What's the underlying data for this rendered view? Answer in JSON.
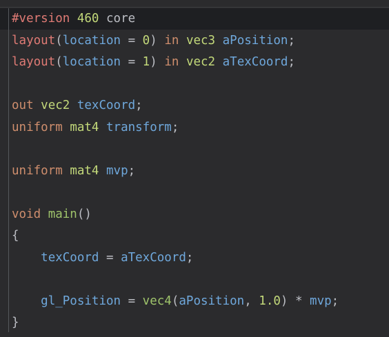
{
  "code": {
    "l1": {
      "directive": "#version",
      "sp1": " ",
      "version": "460",
      "sp2": " ",
      "profile": "core"
    },
    "l2": {
      "kw": "layout",
      "open": "(",
      "loc": "location",
      "eq": " = ",
      "idx": "0",
      "close": ")",
      "sp1": " ",
      "in": "in",
      "sp2": " ",
      "type": "vec3",
      "sp3": " ",
      "name": "aPosition",
      "semi": ";"
    },
    "l3": {
      "kw": "layout",
      "open": "(",
      "loc": "location",
      "eq": " = ",
      "idx": "1",
      "close": ")",
      "sp1": " ",
      "in": "in",
      "sp2": " ",
      "type": "vec2",
      "sp3": " ",
      "name": "aTexCoord",
      "semi": ";"
    },
    "l5": {
      "kw": "out",
      "sp1": " ",
      "type": "vec2",
      "sp2": " ",
      "name": "texCoord",
      "semi": ";"
    },
    "l6": {
      "kw": "uniform",
      "sp1": " ",
      "type": "mat4",
      "sp2": " ",
      "name": "transform",
      "semi": ";"
    },
    "l8": {
      "kw": "uniform",
      "sp1": " ",
      "type": "mat4",
      "sp2": " ",
      "name": "mvp",
      "semi": ";"
    },
    "l10": {
      "kw": "void",
      "sp1": " ",
      "name": "main",
      "parens": "()"
    },
    "l11": {
      "brace": "{"
    },
    "l12": {
      "indent": "    ",
      "lhs": "texCoord",
      "eq": " = ",
      "rhs": "aTexCoord",
      "semi": ";"
    },
    "l14": {
      "indent": "    ",
      "lhs": "gl_Position",
      "eq": " = ",
      "fn": "vec4",
      "open": "(",
      "a1": "aPosition",
      "comma": ", ",
      "a2": "1.0",
      "close": ")",
      "mul": " * ",
      "a3": "mvp",
      "semi": ";"
    },
    "l15": {
      "brace": "}"
    }
  },
  "colors": {
    "background": "#2b2b2d",
    "current_line": "#1e1f22",
    "keyword": "#cf8e6d",
    "directive": "#e07b75",
    "type": "#c3d97a",
    "identifier": "#6fa8dc",
    "function": "#9fc46b",
    "plain": "#bcbec4"
  }
}
